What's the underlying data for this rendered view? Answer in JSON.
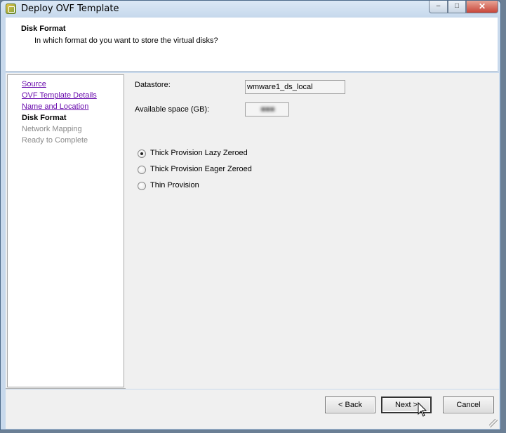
{
  "window": {
    "title": "Deploy OVF Template",
    "controls": {
      "minimize": "–",
      "maximize": "□",
      "close": "✕"
    }
  },
  "header": {
    "title": "Disk Format",
    "subtitle": "In which format do you want to store the virtual disks?"
  },
  "nav": {
    "items": [
      {
        "label": "Source",
        "state": "link"
      },
      {
        "label": "OVF Template Details",
        "state": "link"
      },
      {
        "label": "Name and Location",
        "state": "link"
      },
      {
        "label": "Disk Format",
        "state": "current"
      },
      {
        "label": "Network Mapping",
        "state": "disabled"
      },
      {
        "label": "Ready to Complete",
        "state": "disabled"
      }
    ]
  },
  "form": {
    "datastore_label": "Datastore:",
    "datastore_value": "wmware1_ds_local",
    "available_label": "Available space (GB):",
    "available_value": "■■■"
  },
  "disk_options": [
    {
      "label": "Thick Provision Lazy Zeroed",
      "checked": true
    },
    {
      "label": "Thick Provision Eager Zeroed",
      "checked": false
    },
    {
      "label": "Thin Provision",
      "checked": false
    }
  ],
  "buttons": {
    "back": "< Back",
    "next": "Next >",
    "cancel": "Cancel"
  },
  "colors": {
    "link": "#6a0dad",
    "disabled": "#8a8a8a",
    "window_frame": "#c8d9ec"
  }
}
